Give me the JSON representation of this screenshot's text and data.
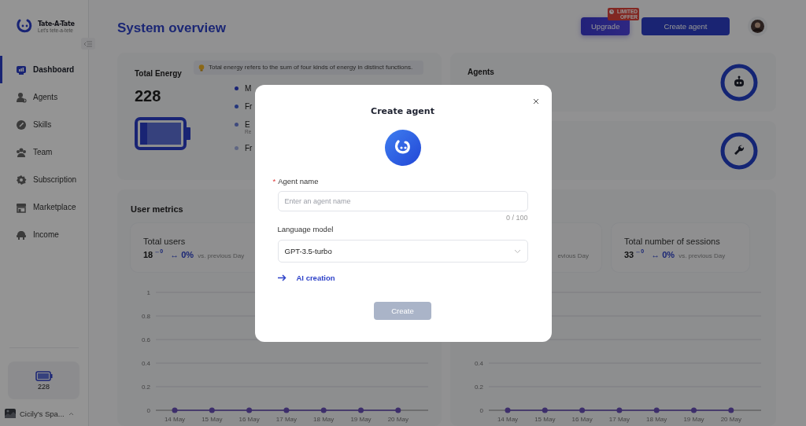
{
  "sidebar": {
    "logo": {
      "name": "Tate-A-Tate",
      "tagline": "Let's tete-a-tete"
    },
    "items": [
      {
        "label": "Dashboard",
        "selected": true
      },
      {
        "label": "Agents",
        "selected": false
      },
      {
        "label": "Skills",
        "selected": false
      },
      {
        "label": "Team",
        "selected": false
      },
      {
        "label": "Subscription",
        "selected": false
      },
      {
        "label": "Marketplace",
        "selected": false
      },
      {
        "label": "Income",
        "selected": false
      }
    ],
    "energy": "228",
    "workspace": "Cicily's Spa..."
  },
  "header": {
    "title": "System overview",
    "buttons": [
      {
        "label": "Upgrade",
        "kind": "upgrade",
        "badge": "LIMITED OFFER"
      },
      {
        "label": "Create agent",
        "kind": "primary"
      }
    ]
  },
  "energy_card": {
    "title": "Total Energy",
    "value": "228",
    "info": "Total energy refers to the sum of four kinds of energy in distinct functions.",
    "legend": [
      {
        "label": "M",
        "color": "#1a2475"
      },
      {
        "label": "Fr",
        "color": "#25377c"
      },
      {
        "label": "E",
        "sub": "Re",
        "color": "#3f4a7d"
      },
      {
        "label": "Fr",
        "color": "#606783"
      }
    ]
  },
  "agents_card": {
    "title": "Agents"
  },
  "metric_panels": [
    {
      "title": "User metrics",
      "cards": [
        {
          "title": "Total users",
          "value": "18",
          "delta": "↔0",
          "change": "↔ 0%",
          "note": "vs. previous Day"
        }
      ],
      "chart_data": {
        "type": "line",
        "categories": [
          "14 May",
          "15 May",
          "16 May",
          "17 May",
          "18 May",
          "19 May",
          "20 May"
        ],
        "series": [
          {
            "color": "#3d2e6b",
            "marker": true,
            "values": [
              0,
              0,
              0,
              0,
              0,
              0,
              0
            ]
          }
        ],
        "grid": true,
        "ylim": [
          0,
          1
        ],
        "yticks": [
          0,
          0.2,
          0.4,
          0.6,
          0.8,
          1
        ]
      }
    },
    {
      "cards": [
        {
          "note": "evious Day"
        },
        {
          "title": "Total number of sessions",
          "value": "33",
          "delta": "↔0",
          "change": "↔ 0%",
          "note": "vs. previous Day"
        }
      ],
      "chart_data": {
        "type": "line",
        "categories": [
          "14 May",
          "15 May",
          "16 May",
          "17 May",
          "18 May",
          "19 May",
          "20 May"
        ],
        "series": [
          {
            "color": "#3d2e6b",
            "marker": true,
            "values": [
              0,
              0,
              0,
              0,
              0,
              0,
              0
            ]
          }
        ],
        "grid": true,
        "ylim": [
          0,
          1
        ],
        "yticks": [
          0,
          0.2,
          0.4
        ]
      }
    }
  ],
  "dialog": {
    "title": "Create agent",
    "name_label": "Agent name",
    "required_mark": "*",
    "name_placeholder": "Enter an agent name",
    "counter": "0 / 100",
    "model_label": "Language model",
    "model_value": "GPT-3.5-turbo",
    "link": "AI creation",
    "submit": {
      "label": "Create",
      "disabled": true
    }
  }
}
